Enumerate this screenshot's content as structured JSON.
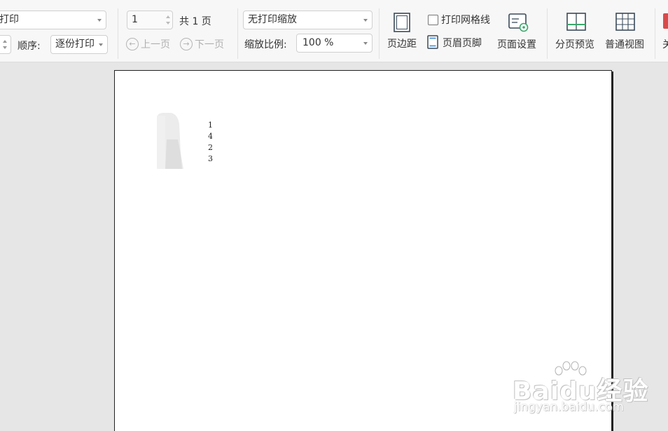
{
  "toolbar": {
    "print_mode": "打印",
    "order_label": "顺序:",
    "order_value": "逐份打印",
    "page_input": "1",
    "total_pages": "共 1 页",
    "prev_page": "上一页",
    "next_page": "下一页",
    "scaling_mode": "无打印缩放",
    "zoom_label": "缩放比例:",
    "zoom_value": "100 %",
    "margins": "页边距",
    "print_gridlines": "打印网格线",
    "print_gridlines_checked": false,
    "header_footer": "页眉页脚",
    "page_setup": "页面设置",
    "page_break_preview": "分页预览",
    "normal_view": "普通视图",
    "close_partial": "关"
  },
  "preview": {
    "cells": [
      "1",
      "4",
      "2",
      "3"
    ]
  },
  "watermark": {
    "brand": "Baidu经验",
    "url": "jingyan.baidu.com"
  },
  "colors": {
    "accent_red": "#d84a4a",
    "toolbar_bg": "#f7f7f7",
    "canvas_bg": "#e6e6e6"
  }
}
